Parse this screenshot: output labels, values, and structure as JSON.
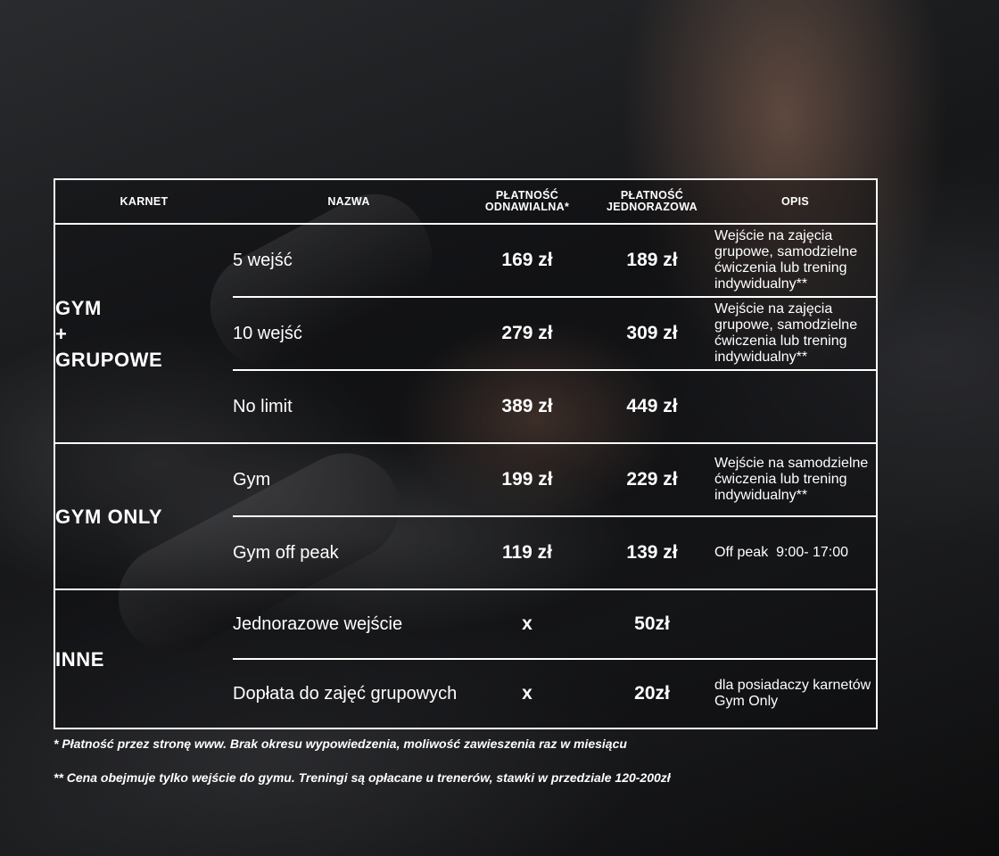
{
  "headers": {
    "karnet": "KARNET",
    "nazwa": "NAZWA",
    "odnawialna_1": "PŁATNOŚĆ",
    "odnawialna_2": "ODNAWIALNA*",
    "jednorazowa_1": "PŁATNOŚĆ",
    "jednorazowa_2": "JEDNORAZOWA",
    "opis": "OPIS"
  },
  "groups": [
    {
      "category_lines": [
        "GYM",
        "+",
        "GRUPOWE"
      ],
      "rows": [
        {
          "name": "5 wejść",
          "renewable": "169 zł",
          "one_time": "189 zł",
          "description": "Wejście na zajęcia grupowe, samodzielne ćwiczenia lub trening indywidualny**"
        },
        {
          "name": "10 wejść",
          "renewable": "279 zł",
          "one_time": "309 zł",
          "description": "Wejście na zajęcia grupowe, samodzielne ćwiczenia lub trening indywidualny**"
        },
        {
          "name": "No limit",
          "renewable": "389 zł",
          "one_time": "449 zł",
          "description": ""
        }
      ]
    },
    {
      "category_lines": [
        "GYM ONLY"
      ],
      "rows": [
        {
          "name": "Gym",
          "renewable": "199 zł",
          "one_time": "229 zł",
          "description": "Wejście na samodzielne ćwiczenia lub trening indywidualny**"
        },
        {
          "name": "Gym off peak",
          "renewable": "119 zł",
          "one_time": "139 zł",
          "description": "Off peak  9:00- 17:00"
        }
      ]
    },
    {
      "category_lines": [
        "INNE"
      ],
      "rows": [
        {
          "name": "Jednorazowe wejście",
          "renewable": "x",
          "one_time": "50zł",
          "description": ""
        },
        {
          "name": "Dopłata do zajęć grupowych",
          "renewable": "x",
          "one_time": "20zł",
          "description": "dla posiadaczy karnetów Gym Only"
        }
      ]
    }
  ],
  "footnotes": {
    "note1": "* Płatność przez stronę www. Brak okresu wypowiedzenia, moliwość zawieszenia raz w miesiącu",
    "note2": "** Cena obejmuje tylko wejście do gymu. Treningi są opłacane u trenerów, stawki w przedziale  120-200zł"
  }
}
